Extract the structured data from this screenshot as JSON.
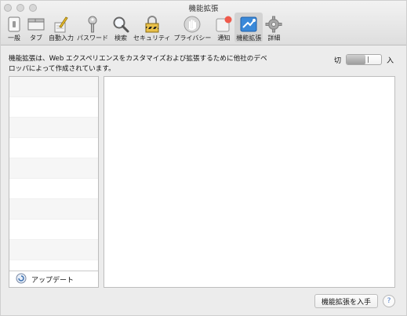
{
  "window": {
    "title": "機能拡張"
  },
  "toolbar": {
    "items": [
      {
        "label": "一般",
        "icon": "general-icon"
      },
      {
        "label": "タブ",
        "icon": "tabs-icon"
      },
      {
        "label": "自動入力",
        "icon": "autofill-icon"
      },
      {
        "label": "パスワード",
        "icon": "password-key-icon"
      },
      {
        "label": "検索",
        "icon": "search-icon"
      },
      {
        "label": "セキュリティ",
        "icon": "security-lock-icon"
      },
      {
        "label": "プライバシー",
        "icon": "privacy-hand-icon"
      },
      {
        "label": "通知",
        "icon": "notifications-icon"
      },
      {
        "label": "機能拡張",
        "icon": "extensions-icon",
        "selected": true
      },
      {
        "label": "詳細",
        "icon": "advanced-gear-icon"
      }
    ]
  },
  "content": {
    "description_line1": "機能拡張は、Web エクスペリエンスをカスタマイズおよび拡張するために他社のデベ",
    "description_line2": "ロッパによって作成されています。",
    "toggle": {
      "off_label": "切",
      "on_label": "入",
      "state": "off"
    }
  },
  "sidebar": {
    "update_label": "アップデート"
  },
  "footer": {
    "gallery_button_label": "機能拡張を入手",
    "help_label": "?"
  },
  "colors": {
    "selected_toolbar_bg": "#d3d3d3",
    "extensions_icon_blue": "#3a89d9",
    "notification_badge": "#ef5a4c"
  }
}
